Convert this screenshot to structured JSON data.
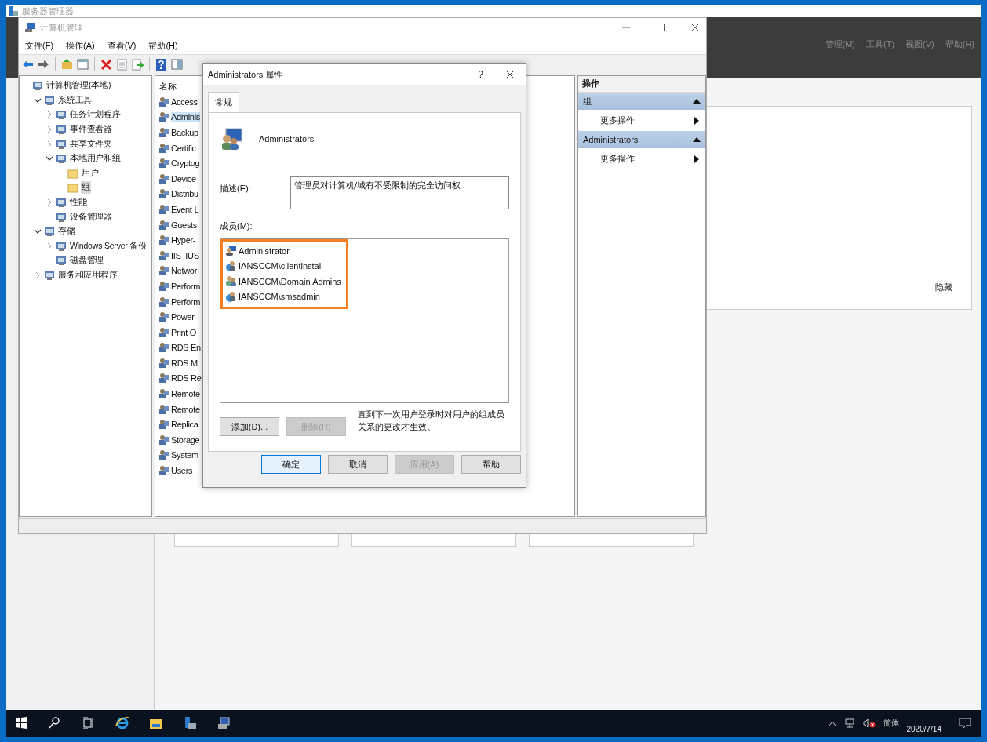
{
  "server_manager": {
    "title": "服务器管理器",
    "menu": [
      "管理(M)",
      "工具(T)",
      "视图(V)",
      "帮助(H)"
    ],
    "hide_label": "隐藏"
  },
  "computer_management": {
    "title": "计算机管理",
    "menu": [
      "文件(F)",
      "操作(A)",
      "查看(V)",
      "帮助(H)"
    ],
    "tree": [
      {
        "label": "计算机管理(本地)",
        "selected": false,
        "children": [
          {
            "label": "系统工具",
            "expanded": true,
            "selected": false,
            "children": [
              {
                "label": "任务计划程序",
                "expanded": false,
                "selected": false
              },
              {
                "label": "事件查看器",
                "expanded": false,
                "selected": false
              },
              {
                "label": "共享文件夹",
                "expanded": false,
                "selected": false
              },
              {
                "label": "本地用户和组",
                "expanded": true,
                "selected": false,
                "children": [
                  {
                    "label": "用户",
                    "selected": false
                  },
                  {
                    "label": "组",
                    "selected": true
                  }
                ]
              },
              {
                "label": "性能",
                "expanded": false,
                "selected": false
              },
              {
                "label": "设备管理器",
                "selected": false
              }
            ]
          },
          {
            "label": "存储",
            "expanded": true,
            "selected": false,
            "children": [
              {
                "label": "Windows Server 备份",
                "expanded": false,
                "selected": false
              },
              {
                "label": "磁盘管理",
                "selected": false
              }
            ]
          },
          {
            "label": "服务和应用程序",
            "expanded": false,
            "selected": false
          }
        ]
      }
    ],
    "list": {
      "column": "名称",
      "rows": [
        {
          "name": "Access",
          "selected": false
        },
        {
          "name": "Adminis",
          "selected": true
        },
        {
          "name": "Backup",
          "selected": false
        },
        {
          "name": "Certific",
          "selected": false
        },
        {
          "name": "Cryptog",
          "selected": false
        },
        {
          "name": "Device",
          "selected": false
        },
        {
          "name": "Distribu",
          "selected": false
        },
        {
          "name": "Event L",
          "selected": false
        },
        {
          "name": "Guests",
          "selected": false
        },
        {
          "name": "Hyper-",
          "selected": false
        },
        {
          "name": "IIS_IUS",
          "selected": false
        },
        {
          "name": "Networ",
          "selected": false
        },
        {
          "name": "Perform",
          "selected": false
        },
        {
          "name": "Perform",
          "selected": false
        },
        {
          "name": "Power",
          "selected": false
        },
        {
          "name": "Print O",
          "selected": false
        },
        {
          "name": "RDS En",
          "selected": false
        },
        {
          "name": "RDS M",
          "selected": false
        },
        {
          "name": "RDS Re",
          "selected": false
        },
        {
          "name": "Remote",
          "selected": false
        },
        {
          "name": "Remote",
          "selected": false
        },
        {
          "name": "Replica",
          "selected": false
        },
        {
          "name": "Storage",
          "selected": false
        },
        {
          "name": "System",
          "selected": false
        },
        {
          "name": "Users",
          "selected": false
        }
      ]
    },
    "actions": {
      "header": "操作",
      "sections": [
        {
          "title": "组",
          "items": [
            "更多操作"
          ]
        },
        {
          "title": "Administrators",
          "items": [
            "更多操作"
          ]
        }
      ]
    }
  },
  "dialog": {
    "title": "Administrators 属性",
    "help": "?",
    "tabs": [
      {
        "label": "常规",
        "selected": true
      }
    ],
    "group_name": "Administrators",
    "description_label": "描述(E):",
    "description": "管理员对计算机/域有不受限制的完全访问权",
    "members_label": "成员(M):",
    "members_highlighted": true,
    "members": [
      {
        "name": "Administrator",
        "kind": "user"
      },
      {
        "name": "IANSCCM\\clientinstall",
        "kind": "domain-user"
      },
      {
        "name": "IANSCCM\\Domain Admins",
        "kind": "group"
      },
      {
        "name": "IANSCCM\\smsadmin",
        "kind": "domain-user"
      }
    ],
    "member_buttons": [
      {
        "label": "添加(D)...",
        "disabled": false
      },
      {
        "label": "删除(R)",
        "disabled": true
      }
    ],
    "note": "直到下一次用户登录时对用户的组成员关系的更改才生效。",
    "buttons": [
      {
        "label": "确定",
        "disabled": false,
        "focused": true
      },
      {
        "label": "取消",
        "disabled": false,
        "focused": false
      },
      {
        "label": "应用(A)",
        "disabled": true,
        "focused": false
      },
      {
        "label": "帮助",
        "disabled": false,
        "focused": false
      }
    ]
  },
  "taskbar": {
    "ime": "简体",
    "date": "2020/7/14"
  }
}
